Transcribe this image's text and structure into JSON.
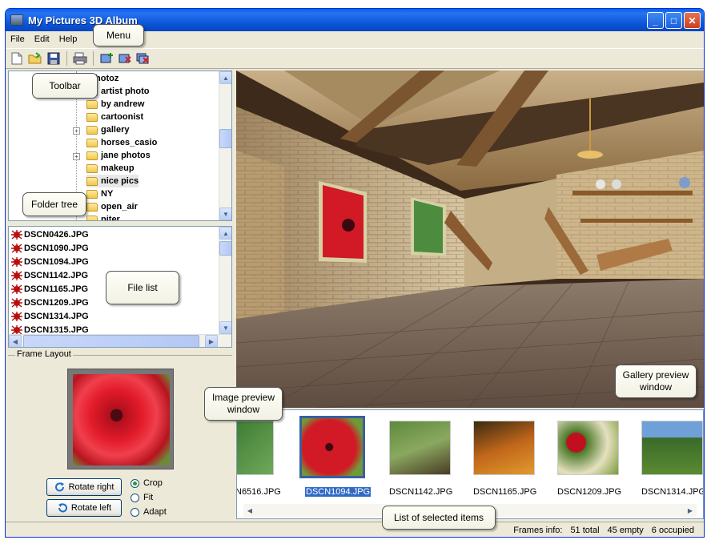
{
  "window": {
    "title": "My Pictures 3D Album",
    "controls": {
      "minimize": "_",
      "maximize": "□",
      "close": "✕"
    }
  },
  "menu": {
    "file": "File",
    "edit": "Edit",
    "help": "Help"
  },
  "toolbar": {
    "icons": [
      "new-icon",
      "open-icon",
      "save-icon",
      "print-icon",
      "add-frame-icon",
      "remove-frame-icon",
      "remove-all-icon"
    ]
  },
  "tree": {
    "items": [
      "hotoz",
      "artist photo",
      "by andrew",
      "cartoonist",
      "gallery",
      "horses_casio",
      "jane photos",
      "makeup",
      "nice pics",
      "NY",
      "open_air",
      "piter"
    ]
  },
  "files": {
    "items": [
      "DSCN0426.JPG",
      "DSCN1090.JPG",
      "DSCN1094.JPG",
      "DSCN1142.JPG",
      "DSCN1165.JPG",
      "DSCN1209.JPG",
      "DSCN1314.JPG",
      "DSCN1315.JPG"
    ]
  },
  "frame_layout": {
    "label": "Frame Layout",
    "rotate_right": "Rotate right",
    "rotate_left": "Rotate left",
    "options": [
      "Crop",
      "Fit",
      "Adapt"
    ],
    "selected": "Crop"
  },
  "thumbnails": {
    "items": [
      "N6516.JPG",
      "DSCN1094.JPG",
      "DSCN1142.JPG",
      "DSCN1165.JPG",
      "DSCN1209.JPG",
      "DSCN1314.JPG"
    ],
    "selected": "DSCN1094.JPG"
  },
  "status": {
    "label": "Frames info:",
    "total": "51 total",
    "empty": "45 empty",
    "occupied": "6 occupied"
  },
  "callouts": {
    "menu": "Menu",
    "toolbar": "Toolbar",
    "folder_tree": "Folder tree",
    "file_list": "File list",
    "image_preview": "Image preview window",
    "gallery_preview": "Gallery preview window",
    "selected_items": "List of selected items"
  },
  "colors": {
    "titlebar": "#0a53d6",
    "selection": "#316ac5",
    "window_bg": "#ece9d8"
  }
}
